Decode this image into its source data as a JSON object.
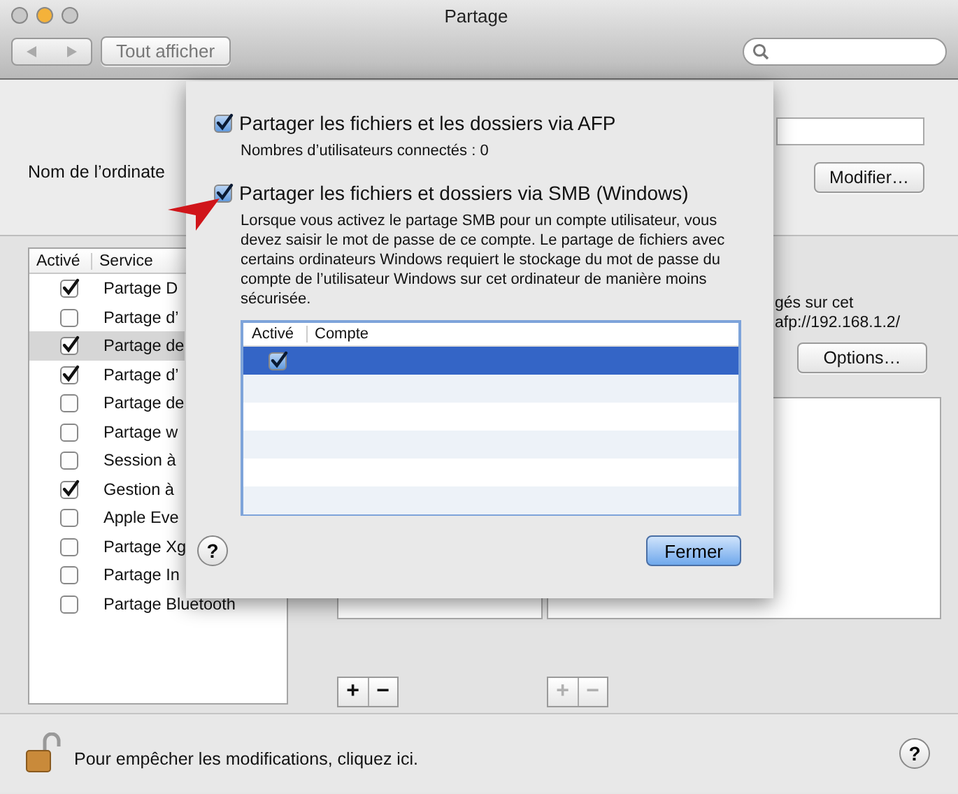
{
  "window": {
    "title": "Partage",
    "show_all": "Tout afficher"
  },
  "computer_name": {
    "label": "Nom de l’ordinate",
    "button": "Modifier…"
  },
  "services": {
    "columns": [
      "Activé",
      "Service"
    ],
    "rows": [
      {
        "name": "Partage D",
        "checked": true,
        "selected": false
      },
      {
        "name": "Partage d’",
        "checked": false,
        "selected": false
      },
      {
        "name": "Partage de",
        "checked": true,
        "selected": true
      },
      {
        "name": "Partage d’",
        "checked": true,
        "selected": false
      },
      {
        "name": "Partage de",
        "checked": false,
        "selected": false
      },
      {
        "name": "Partage w",
        "checked": false,
        "selected": false
      },
      {
        "name": "Session à",
        "checked": false,
        "selected": false
      },
      {
        "name": "Gestion à",
        "checked": true,
        "selected": false
      },
      {
        "name": "Apple Eve",
        "checked": false,
        "selected": false
      },
      {
        "name": "Partage Xg",
        "checked": false,
        "selected": false
      },
      {
        "name": "Partage In",
        "checked": false,
        "selected": false
      },
      {
        "name": "Partage Bluetooth",
        "checked": false,
        "selected": false
      }
    ]
  },
  "details": {
    "lines": [
      "gés sur cet",
      "afp://192.168.1.2/"
    ],
    "options_button": "Options…"
  },
  "list_buttons": [
    {
      "add": "+",
      "remove": "−",
      "disabled": false
    },
    {
      "add": "+",
      "remove": "−",
      "disabled": true
    }
  ],
  "sheet": {
    "afp": {
      "label": "Partager les fichiers et les dossiers via AFP",
      "checked": true
    },
    "connected": "Nombres d’utilisateurs connectés : 0",
    "smb": {
      "label": "Partager les fichiers et dossiers via SMB (Windows)",
      "checked": true
    },
    "description": "Lorsque vous activez le partage SMB pour un compte utilisateur, vous devez saisir le mot de passe de ce compte. Le partage de fichiers avec certains ordinateurs Windows requiert le stockage du mot de passe du compte de l’utilisateur Windows sur cet ordinateur de manière moins sécurisée.",
    "accounts": {
      "columns": [
        "Activé",
        "Compte"
      ],
      "rows": [
        {
          "checked": true,
          "selected": true
        }
      ]
    },
    "help": "?",
    "close_button": "Fermer"
  },
  "footer": {
    "lock_text": "Pour empêcher les modifications, cliquez ici.",
    "help": "?"
  }
}
